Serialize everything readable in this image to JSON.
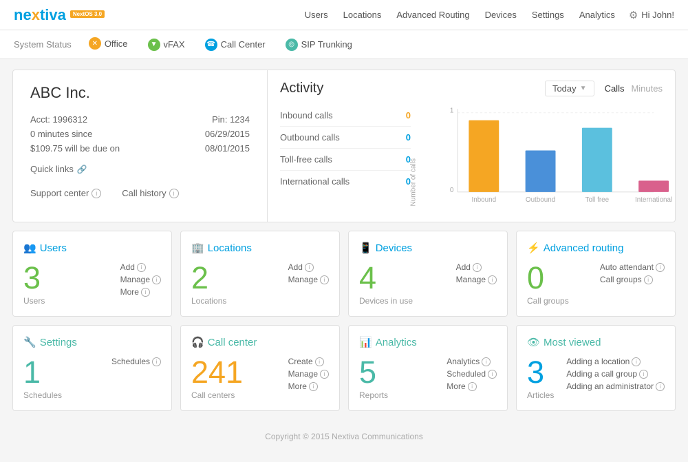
{
  "app": {
    "logo": "nextiva",
    "logo_badge": "NextOS 3.0",
    "nav": {
      "links": [
        "Users",
        "Locations",
        "Advanced Routing",
        "Devices",
        "Settings",
        "Analytics"
      ],
      "user_greeting": "Hi John!"
    },
    "sub_nav": {
      "label": "System Status",
      "items": [
        {
          "id": "office",
          "label": "Office",
          "icon": "⚡",
          "icon_class": "icon-orange"
        },
        {
          "id": "vfax",
          "label": "vFAX",
          "icon": "▼",
          "icon_class": "icon-green"
        },
        {
          "id": "call-center",
          "label": "Call Center",
          "icon": "☎",
          "icon_class": "icon-blue"
        },
        {
          "id": "sip",
          "label": "SIP Trunking",
          "icon": "◎",
          "icon_class": "icon-teal"
        }
      ]
    }
  },
  "info_panel": {
    "company": "ABC Inc.",
    "acct_label": "Acct: 1996312",
    "pin_label": "Pin: 1234",
    "minutes_label": "0 minutes since",
    "date1": "06/29/2015",
    "due_label": "$109.75 will be due on",
    "date2": "08/01/2015",
    "quick_links": "Quick links",
    "support_center": "Support center",
    "call_history": "Call history"
  },
  "activity": {
    "title": "Activity",
    "period": "Today",
    "toggle": [
      "Calls",
      "Minutes"
    ],
    "stats": [
      {
        "label": "Inbound calls",
        "value": "0",
        "color": "orange"
      },
      {
        "label": "Outbound calls",
        "value": "0",
        "color": "blue"
      },
      {
        "label": "Toll-free calls",
        "value": "0",
        "color": "blue"
      },
      {
        "label": "International calls",
        "value": "0",
        "color": "blue"
      }
    ],
    "chart": {
      "labels": [
        "Inbound",
        "Outbound",
        "Toll free",
        "International"
      ],
      "values": [
        85,
        45,
        72,
        12
      ],
      "colors": [
        "#f5a623",
        "#4a90d9",
        "#5bc0de",
        "#d9608c"
      ],
      "y_label": "Number of calls",
      "y_max": 1,
      "y_min": 0
    }
  },
  "dashboard": {
    "cards": [
      {
        "id": "users",
        "title": "Users",
        "icon": "👥",
        "title_color": "blue",
        "number": "3",
        "number_color": "green",
        "sub": "Users",
        "actions": [
          "Add",
          "Manage",
          "More"
        ]
      },
      {
        "id": "locations",
        "title": "Locations",
        "icon": "🏢",
        "title_color": "blue",
        "number": "2",
        "number_color": "green",
        "sub": "Locations",
        "actions": [
          "Add",
          "Manage"
        ]
      },
      {
        "id": "devices",
        "title": "Devices",
        "icon": "📱",
        "title_color": "blue",
        "number": "4",
        "number_color": "green",
        "sub": "Devices in use",
        "actions": [
          "Add",
          "Manage"
        ]
      },
      {
        "id": "advanced-routing",
        "title": "Advanced routing",
        "icon": "⚡",
        "title_color": "blue",
        "number": "0",
        "number_color": "green",
        "sub": "Call groups",
        "actions": [
          "Auto attendant",
          "Call groups"
        ]
      },
      {
        "id": "settings",
        "title": "Settings",
        "icon": "🔧",
        "title_color": "teal",
        "number": "1",
        "number_color": "teal",
        "sub": "Schedules",
        "actions": [
          "Schedules"
        ]
      },
      {
        "id": "call-center",
        "title": "Call center",
        "icon": "🎧",
        "title_color": "teal",
        "number": "241",
        "number_color": "orange",
        "sub": "Call centers",
        "actions": [
          "Create",
          "Manage",
          "More"
        ]
      },
      {
        "id": "analytics",
        "title": "Analytics",
        "icon": "📊",
        "title_color": "teal",
        "number": "5",
        "number_color": "teal",
        "sub": "Reports",
        "actions": [
          "Analytics",
          "Scheduled",
          "More"
        ]
      },
      {
        "id": "most-viewed",
        "title": "Most viewed",
        "icon": "👁",
        "title_color": "teal",
        "number": "3",
        "number_color": "blue",
        "sub": "Articles",
        "actions": [
          "Adding a location",
          "Adding a call group",
          "Adding an administrator"
        ]
      }
    ]
  },
  "footer": {
    "text": "Copyright © 2015 Nextiva Communications"
  }
}
